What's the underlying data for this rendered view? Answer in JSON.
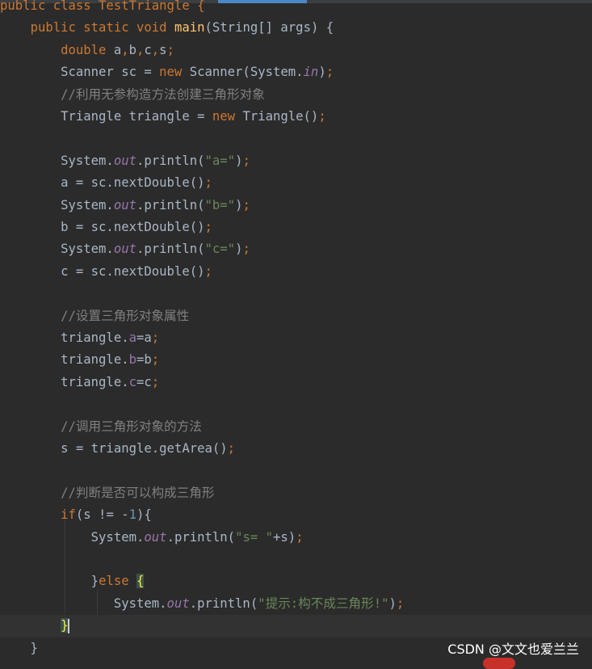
{
  "colors": {
    "background": "#2b2b2b",
    "default_text": "#a9b7c6",
    "keyword": "#cc7832",
    "method_declaration": "#ffc66d",
    "static_field": "#9876aa",
    "string": "#6a8759",
    "number": "#6897bb",
    "comment": "#808080",
    "current_line": "#323232",
    "brace_match": "#3b514d"
  },
  "code_lines": [
    {
      "tokens": [
        {
          "t": "public class TestTriangle {",
          "c": "#cc7832"
        }
      ]
    },
    {
      "tokens": [
        {
          "t": "    "
        },
        {
          "t": "public static void ",
          "c": "#cc7832"
        },
        {
          "t": "main",
          "c": "#ffc66d"
        },
        {
          "t": "(String[] args) {"
        }
      ]
    },
    {
      "tokens": [
        {
          "t": "        "
        },
        {
          "t": "double ",
          "c": "#cc7832"
        },
        {
          "t": "a"
        },
        {
          "t": ",",
          "c": "#cc7832"
        },
        {
          "t": "b"
        },
        {
          "t": ",",
          "c": "#cc7832"
        },
        {
          "t": "c"
        },
        {
          "t": ",",
          "c": "#cc7832"
        },
        {
          "t": "s"
        },
        {
          "t": ";",
          "c": "#cc7832"
        }
      ]
    },
    {
      "tokens": [
        {
          "t": "        Scanner sc = "
        },
        {
          "t": "new ",
          "c": "#cc7832"
        },
        {
          "t": "Scanner(System."
        },
        {
          "t": "in",
          "c": "#9876aa",
          "i": true
        },
        {
          "t": ")"
        },
        {
          "t": ";",
          "c": "#cc7832"
        }
      ]
    },
    {
      "tokens": [
        {
          "t": "        //利用无参构造方法创建三角形对象",
          "c": "#808080"
        }
      ]
    },
    {
      "tokens": [
        {
          "t": "        Triangle triangle = "
        },
        {
          "t": "new ",
          "c": "#cc7832"
        },
        {
          "t": "Triangle()"
        },
        {
          "t": ";",
          "c": "#cc7832"
        }
      ]
    },
    {
      "tokens": []
    },
    {
      "tokens": [
        {
          "t": "        System."
        },
        {
          "t": "out",
          "c": "#9876aa",
          "i": true
        },
        {
          "t": ".println("
        },
        {
          "t": "\"a=\"",
          "c": "#6a8759"
        },
        {
          "t": ")"
        },
        {
          "t": ";",
          "c": "#cc7832"
        }
      ]
    },
    {
      "tokens": [
        {
          "t": "        a = sc.nextDouble()"
        },
        {
          "t": ";",
          "c": "#cc7832"
        }
      ]
    },
    {
      "tokens": [
        {
          "t": "        System."
        },
        {
          "t": "out",
          "c": "#9876aa",
          "i": true
        },
        {
          "t": ".println("
        },
        {
          "t": "\"b=\"",
          "c": "#6a8759"
        },
        {
          "t": ")"
        },
        {
          "t": ";",
          "c": "#cc7832"
        }
      ]
    },
    {
      "tokens": [
        {
          "t": "        b = sc.nextDouble()"
        },
        {
          "t": ";",
          "c": "#cc7832"
        }
      ]
    },
    {
      "tokens": [
        {
          "t": "        System."
        },
        {
          "t": "out",
          "c": "#9876aa",
          "i": true
        },
        {
          "t": ".println("
        },
        {
          "t": "\"c=\"",
          "c": "#6a8759"
        },
        {
          "t": ")"
        },
        {
          "t": ";",
          "c": "#cc7832"
        }
      ]
    },
    {
      "tokens": [
        {
          "t": "        c = sc.nextDouble()"
        },
        {
          "t": ";",
          "c": "#cc7832"
        }
      ]
    },
    {
      "tokens": []
    },
    {
      "tokens": [
        {
          "t": "        //设置三角形对象属性",
          "c": "#808080"
        }
      ]
    },
    {
      "tokens": [
        {
          "t": "        triangle."
        },
        {
          "t": "a",
          "c": "#9876aa"
        },
        {
          "t": "=a"
        },
        {
          "t": ";",
          "c": "#cc7832"
        }
      ]
    },
    {
      "tokens": [
        {
          "t": "        triangle."
        },
        {
          "t": "b",
          "c": "#9876aa"
        },
        {
          "t": "=b"
        },
        {
          "t": ";",
          "c": "#cc7832"
        }
      ]
    },
    {
      "tokens": [
        {
          "t": "        triangle."
        },
        {
          "t": "c",
          "c": "#9876aa"
        },
        {
          "t": "=c"
        },
        {
          "t": ";",
          "c": "#cc7832"
        }
      ]
    },
    {
      "tokens": []
    },
    {
      "tokens": [
        {
          "t": "        //调用三角形对象的方法",
          "c": "#808080"
        }
      ]
    },
    {
      "tokens": [
        {
          "t": "        s = triangle.getArea()"
        },
        {
          "t": ";",
          "c": "#cc7832"
        }
      ]
    },
    {
      "tokens": []
    },
    {
      "tokens": [
        {
          "t": "        //判断是否可以构成三角形",
          "c": "#808080"
        }
      ]
    },
    {
      "tokens": [
        {
          "t": "        "
        },
        {
          "t": "if",
          "c": "#cc7832"
        },
        {
          "t": "(s != -"
        },
        {
          "t": "1",
          "c": "#6897bb"
        },
        {
          "t": "){"
        }
      ]
    },
    {
      "tokens": [
        {
          "t": "            System."
        },
        {
          "t": "out",
          "c": "#9876aa",
          "i": true
        },
        {
          "t": ".println("
        },
        {
          "t": "\"s= \"",
          "c": "#6a8759"
        },
        {
          "t": "+s)"
        },
        {
          "t": ";",
          "c": "#cc7832"
        }
      ]
    },
    {
      "tokens": []
    },
    {
      "tokens": [
        {
          "t": "            }"
        },
        {
          "t": "else ",
          "c": "#cc7832"
        },
        {
          "t": "{",
          "hl": true
        }
      ]
    },
    {
      "tokens": [
        {
          "t": "               System."
        },
        {
          "t": "out",
          "c": "#9876aa",
          "i": true
        },
        {
          "t": ".println("
        },
        {
          "t": "\"提示:构不成三角形!\"",
          "c": "#6a8759"
        },
        {
          "t": ")"
        },
        {
          "t": ";",
          "c": "#cc7832"
        }
      ]
    },
    {
      "tokens": [
        {
          "t": "        "
        },
        {
          "t": "}",
          "hl": true,
          "caret": true
        }
      ],
      "current": true
    },
    {
      "tokens": [
        {
          "t": "    }"
        }
      ]
    }
  ],
  "watermark": "CSDN @文文也爱兰兰"
}
